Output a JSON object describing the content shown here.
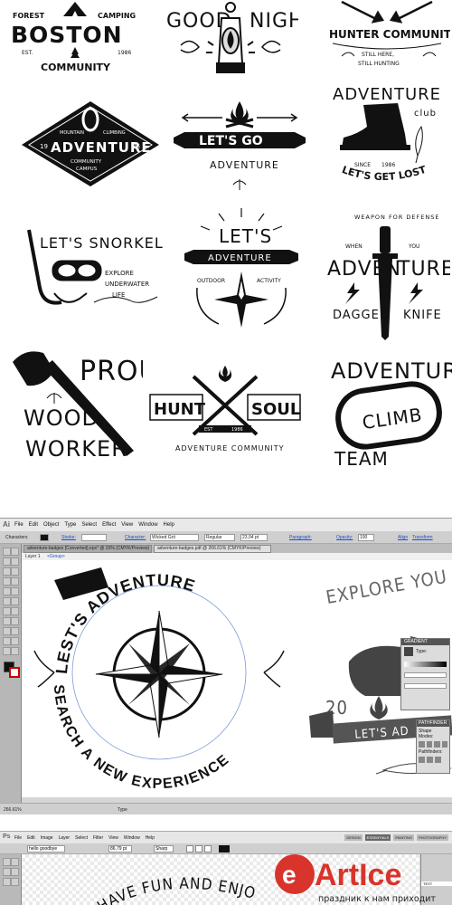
{
  "badges": {
    "boston": {
      "forest": "FOREST",
      "camping": "CAMPING",
      "title": "BOSTON",
      "est": "EST.",
      "year": "1986",
      "community": "COMMUNITY"
    },
    "good_night": {
      "good": "GOOD",
      "night": "NIGHT"
    },
    "hunter": {
      "title": "HUNTER COMMUNITY",
      "line1": "STILL HERE,",
      "line2": "STILL HUNTING"
    },
    "adventure_diamond": {
      "mountain": "MOUNTAIN",
      "climbing": "CLIMBING",
      "num1": "19",
      "num2": "86",
      "title": "ADVENTURE",
      "community": "COMMUNITY",
      "campus": "CAMPUS"
    },
    "lets_go": {
      "title": "LET'S GO",
      "sub": "ADVENTURE"
    },
    "adventure_club": {
      "adventure": "ADVENTURE",
      "club": "club",
      "since": "SINCE",
      "year": "1986",
      "tagline": "LET'S GET LOST"
    },
    "snorkel": {
      "title": "LET'S SNORKEL",
      "line1": "EXPLORE",
      "line2": "UNDERWATER",
      "line3": "LIFE"
    },
    "lets_adventure": {
      "lets": "LET'S",
      "adventure": "ADVENTURE",
      "outdoor": "OUTDOOR",
      "activity": "ACTIVITY"
    },
    "adventures": {
      "weapon": "WEAPON FOR DEFENSE",
      "when": "WHEN",
      "you": "YOU",
      "adven": "ADVEN",
      "tures": "TURES",
      "dagger": "DAGGER",
      "knife": "KNIFE"
    },
    "proud": {
      "proud": "PROUD",
      "wood": "WOOD",
      "worker": "WORKER"
    },
    "hunt_soul": {
      "hunt": "HUNT",
      "soul": "SOUL",
      "est": "EST",
      "year": "1986",
      "community": "ADVENTURE COMMUNITY"
    },
    "climb": {
      "adventure": "ADVENTURE",
      "climb": "CLIMB",
      "team": "TEAM"
    }
  },
  "illustrator": {
    "menu": [
      "File",
      "Edit",
      "Object",
      "Type",
      "Select",
      "Effect",
      "View",
      "Window",
      "Help"
    ],
    "control": {
      "characters": "Characters",
      "stroke": "Stroke:",
      "character_link": "Character:",
      "font": "Wicked Grit",
      "style": "Regular",
      "size": "23.04 pt",
      "paragraph": "Paragraph:",
      "opacity": "Opacity:",
      "opacity_val": "100",
      "align": "Align",
      "transform": "Transform"
    },
    "tabs": [
      "adventure-badges [Converted].eps* @ 33% (CMYK/Preview)",
      "adventure-badges.pdf @ 266.61% (CMYK/Preview)"
    ],
    "layer": "Layer 1",
    "group": "<Group>",
    "artwork": {
      "top_arc": "LEST'S ADVENTURE",
      "bottom_arc": "SEARCH A NEW EXPERIENCE",
      "explore": "EXPLORE YOU",
      "number": "20",
      "lets_ad": "LET'S AD"
    },
    "gradient_panel": {
      "title": "GRADIENT",
      "type": "Type:"
    },
    "pathfinder": {
      "title": "PATHFINDER",
      "shape_modes": "Shape Modes:",
      "pathfinders": "Pathfinders:"
    },
    "status": {
      "zoom": "266.61%",
      "mode": "Type"
    }
  },
  "photoshop": {
    "menu": [
      "File",
      "Edit",
      "Image",
      "Layer",
      "Select",
      "Filter",
      "View",
      "Window",
      "Help"
    ],
    "font": "hello goodbye",
    "size": "86.79 pt",
    "aa": "Sharp",
    "workspaces": [
      "DESIGN",
      "ESSENTIALS",
      "PAINTING",
      "PHOTOGRAPHY"
    ],
    "artwork_text": "HAVE FUN AND ENJOY",
    "layer_text": "TEXT"
  },
  "watermark": {
    "brand": "ArtIce",
    "tagline": "праздник к нам приходит"
  }
}
